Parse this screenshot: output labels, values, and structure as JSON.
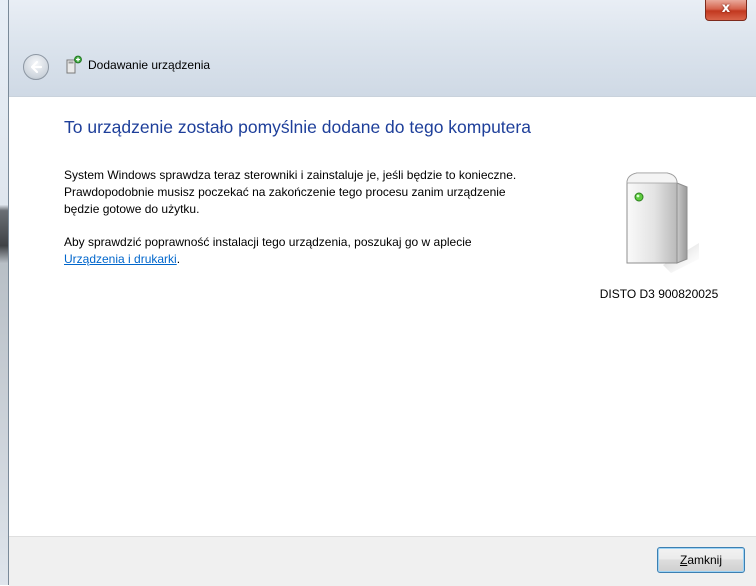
{
  "window": {
    "title": "Dodawanie urządzenia",
    "close_glyph": "x"
  },
  "icons": {
    "back": "back-arrow-icon",
    "title": "add-device-icon",
    "close": "close-icon",
    "device": "generic-device-icon"
  },
  "content": {
    "heading": "To urządzenie zostało pomyślnie dodane do tego komputera",
    "paragraph1": "System Windows sprawdza teraz sterowniki i zainstaluje je, jeśli będzie to konieczne. Prawdopodobnie musisz poczekać na zakończenie tego procesu zanim urządzenie będzie gotowe do użytku.",
    "paragraph2_prefix": "Aby sprawdzić poprawność instalacji tego urządzenia, poszukaj go w aplecie ",
    "paragraph2_link": "Urządzenia i drukarki",
    "paragraph2_suffix": ".",
    "device_name": "DISTO D3 900820025"
  },
  "footer": {
    "close_button_mnemonic": "Z",
    "close_button_rest": "amknij"
  },
  "colors": {
    "heading": "#1e3f9a",
    "link": "#0066cc",
    "close_button_red": "#c2381f"
  }
}
